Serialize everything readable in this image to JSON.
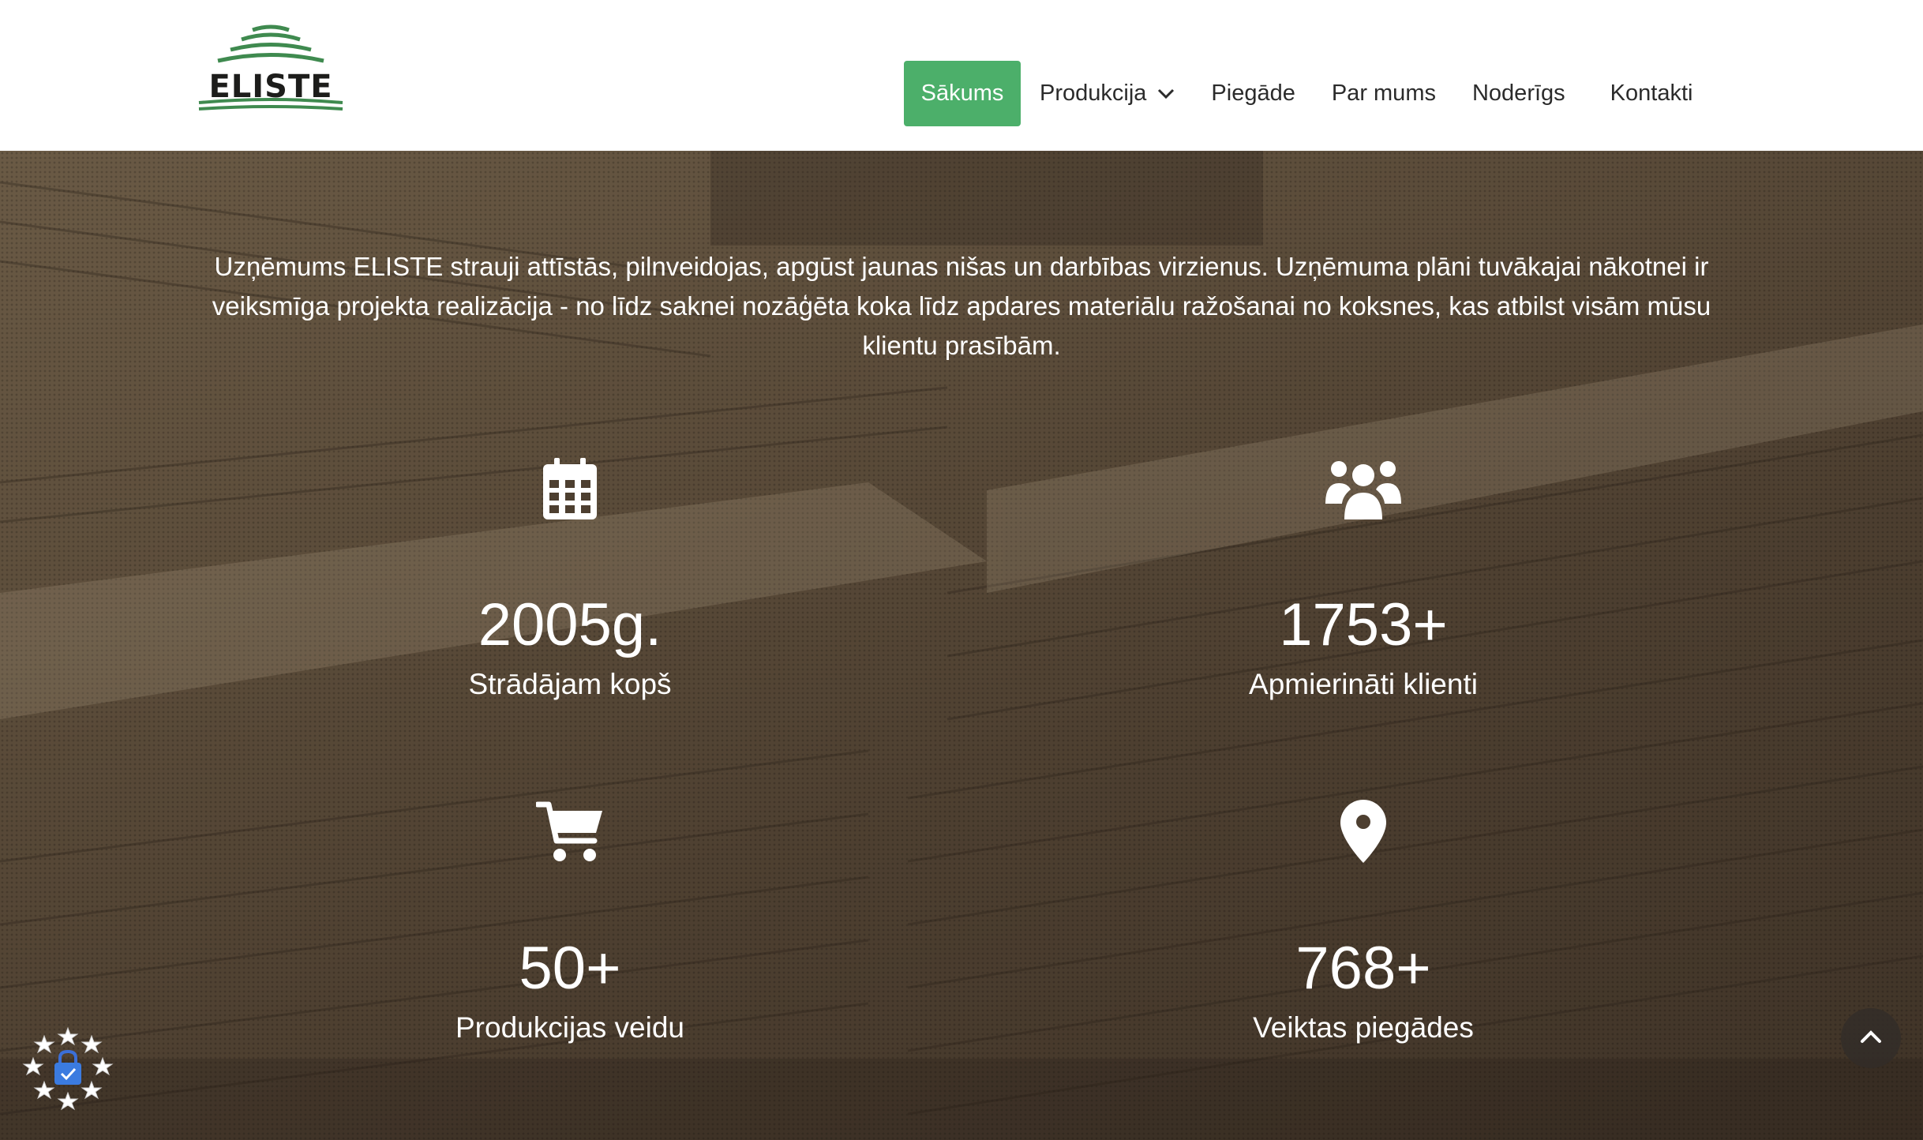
{
  "header": {
    "logo_text": "ELISTE",
    "nav": [
      {
        "label": "Sākums",
        "active": true
      },
      {
        "label": "Produkcija",
        "has_dropdown": true
      },
      {
        "label": "Piegāde"
      },
      {
        "label": "Par mums"
      },
      {
        "label": "Noderīgs"
      },
      {
        "label": "Kontakti"
      }
    ]
  },
  "hero": {
    "intro": "Uzņēmums ELISTE strauji attīstās, pilnveidojas, apgūst jaunas nišas un darbības virzienus. Uzņēmuma plāni tuvākajai nākotnei ir veiksmīga projekta realizācija - no līdz saknei nozāģēta koka līdz apdares materiālu ražošanai no koksnes, kas atbilst visām mūsu klientu prasībām.",
    "stats": [
      {
        "icon": "calendar-icon",
        "value": "2005g.",
        "label": "Strādājam kopš"
      },
      {
        "icon": "users-icon",
        "value": "1753+",
        "label": "Apmierināti klienti"
      },
      {
        "icon": "cart-icon",
        "value": "50+",
        "label": "Produkcijas veidu"
      },
      {
        "icon": "location-pin-icon",
        "value": "768+",
        "label": "Veiktas piegādes"
      }
    ]
  },
  "widgets": {
    "cookie_badge_icon": "eu-stars-lock-icon",
    "scroll_top_icon": "chevron-up-icon"
  },
  "colors": {
    "accent": "#4caf6a",
    "logo_green": "#3f8a4f",
    "hero_overlay": "#4d3f30"
  }
}
